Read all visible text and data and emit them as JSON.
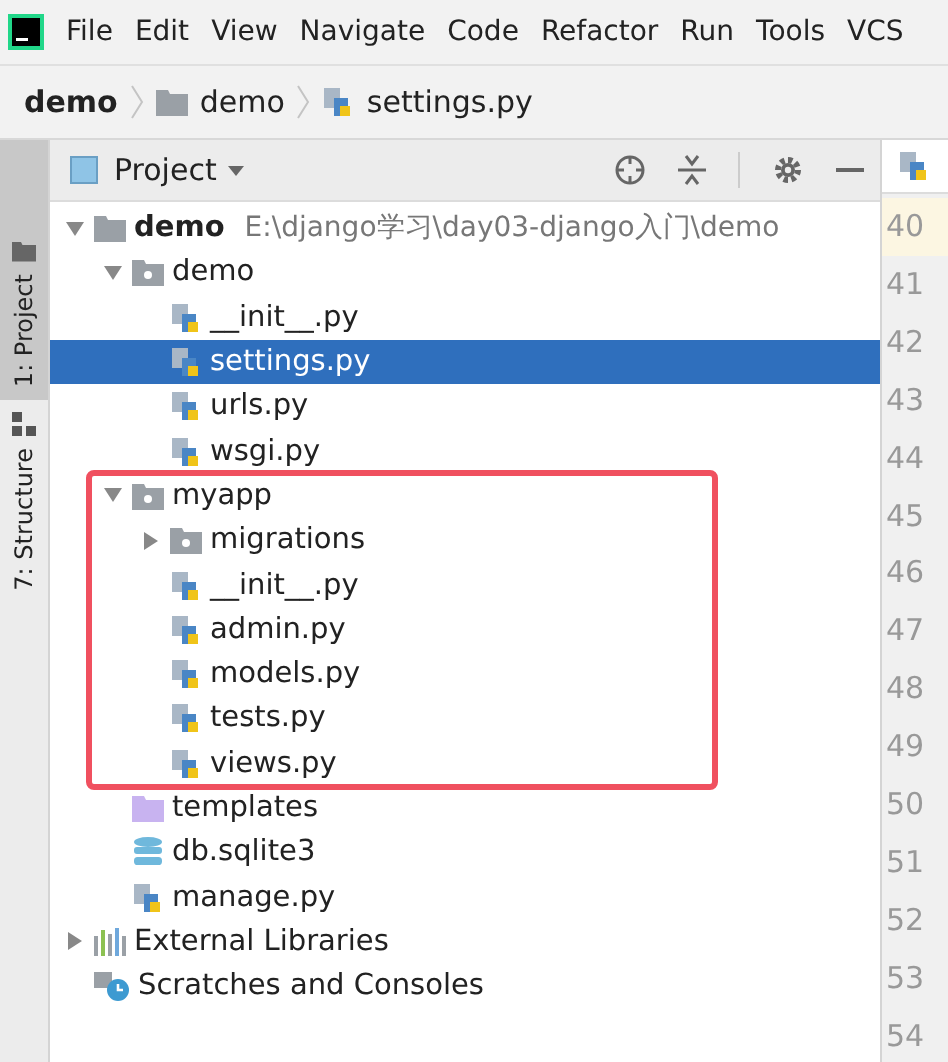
{
  "menu_bar": {
    "items": [
      "File",
      "Edit",
      "View",
      "Navigate",
      "Code",
      "Refactor",
      "Run",
      "Tools",
      "VCS"
    ]
  },
  "breadcrumb": [
    {
      "label": "demo",
      "kind": "project"
    },
    {
      "label": "demo",
      "kind": "folder"
    },
    {
      "label": "settings.py",
      "kind": "python"
    }
  ],
  "side_stripe": [
    {
      "label": "1: Project",
      "kind": "folder",
      "selected": true
    },
    {
      "label": "7: Structure",
      "kind": "structure",
      "selected": false
    }
  ],
  "project_panel": {
    "title": "Project"
  },
  "tree": [
    {
      "label": "demo",
      "path": "E:\\django学习\\day03-django入门\\demo",
      "kind": "folder",
      "expanded": true,
      "selected": false,
      "children": [
        {
          "label": "demo",
          "kind": "package",
          "expanded": true,
          "selected": false,
          "children": [
            {
              "label": "__init__.py",
              "kind": "python",
              "selected": false
            },
            {
              "label": "settings.py",
              "kind": "python",
              "selected": true
            },
            {
              "label": "urls.py",
              "kind": "python",
              "selected": false
            },
            {
              "label": "wsgi.py",
              "kind": "python",
              "selected": false
            }
          ]
        },
        {
          "label": "myapp",
          "kind": "package",
          "expanded": true,
          "selected": false,
          "children": [
            {
              "label": "migrations",
              "kind": "package",
              "expanded": false,
              "selected": false
            },
            {
              "label": "__init__.py",
              "kind": "python",
              "selected": false
            },
            {
              "label": "admin.py",
              "kind": "python",
              "selected": false
            },
            {
              "label": "models.py",
              "kind": "python",
              "selected": false
            },
            {
              "label": "tests.py",
              "kind": "python",
              "selected": false
            },
            {
              "label": "views.py",
              "kind": "python",
              "selected": false
            }
          ]
        },
        {
          "label": "templates",
          "kind": "templates",
          "selected": false
        },
        {
          "label": "db.sqlite3",
          "kind": "database",
          "selected": false
        },
        {
          "label": "manage.py",
          "kind": "python",
          "selected": false
        }
      ]
    },
    {
      "label": "External Libraries",
      "kind": "library",
      "expanded": false,
      "selected": false
    },
    {
      "label": "Scratches and Consoles",
      "kind": "scratches",
      "selected": false
    }
  ],
  "editor": {
    "line_numbers": [
      "40",
      "41",
      "42",
      "43",
      "44",
      "45",
      "46",
      "47",
      "48",
      "49",
      "50",
      "51",
      "52",
      "53",
      "54"
    ]
  }
}
